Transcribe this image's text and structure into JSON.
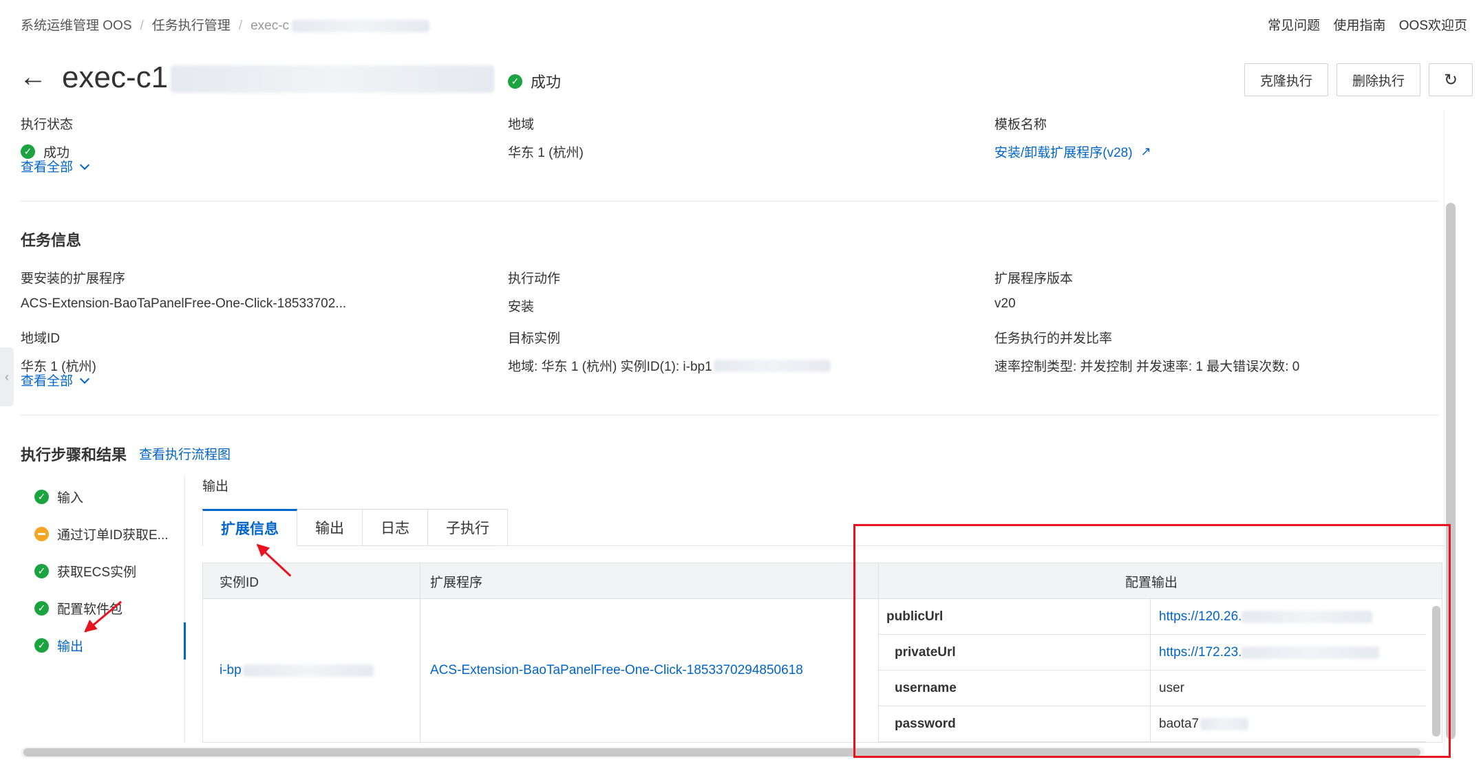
{
  "breadcrumb": {
    "item1": "系统运维管理 OOS",
    "item2": "任务执行管理",
    "current": "exec-c"
  },
  "top_links": {
    "faq": "常见问题",
    "guide": "使用指南",
    "welcome": "OOS欢迎页"
  },
  "header": {
    "title": "exec-c1",
    "status": "成功",
    "clone_button": "克隆执行",
    "delete_button": "删除执行"
  },
  "basic": {
    "status_label": "执行状态",
    "status_value": "成功",
    "region_label": "地域",
    "region_value": "华东 1 (杭州)",
    "template_label": "模板名称",
    "template_value": "安装/卸载扩展程序(v28)",
    "view_all": "查看全部"
  },
  "task_info": {
    "title": "任务信息",
    "ext_label": "要安装的扩展程序",
    "ext_value": "ACS-Extension-BaoTaPanelFree-One-Click-18533702...",
    "action_label": "执行动作",
    "action_value": "安装",
    "version_label": "扩展程序版本",
    "version_value": "v20",
    "regionid_label": "地域ID",
    "regionid_value": "华东 1 (杭州)",
    "target_label": "目标实例",
    "target_value": "地域: 华东 1 (杭州) 实例ID(1): i-bp1",
    "ratio_label": "任务执行的并发比率",
    "ratio_value": "速率控制类型: 并发控制 并发速率: 1 最大错误次数: 0",
    "view_all": "查看全部"
  },
  "steps_section": {
    "title": "执行步骤和结果",
    "flow_link": "查看执行流程图",
    "steps": [
      {
        "label": "输入",
        "status": "success"
      },
      {
        "label": "通过订单ID获取E...",
        "status": "warning"
      },
      {
        "label": "获取ECS实例",
        "status": "success"
      },
      {
        "label": "配置软件包",
        "status": "success"
      },
      {
        "label": "输出",
        "status": "success"
      }
    ]
  },
  "output": {
    "label": "输出",
    "tabs": [
      "扩展信息",
      "输出",
      "日志",
      "子执行"
    ],
    "table": {
      "headers": [
        "实例ID",
        "扩展程序",
        "配置输出"
      ],
      "instance_id": "i-bp",
      "extension": "ACS-Extension-BaoTaPanelFree-One-Click-1853370294850618",
      "config": [
        {
          "key": "publicUrl",
          "value": "https://120.26."
        },
        {
          "key": "privateUrl",
          "value": "https://172.23."
        },
        {
          "key": "username",
          "value": "user"
        },
        {
          "key": "password",
          "value": "baota7"
        }
      ]
    }
  },
  "colors": {
    "link": "#0064c8",
    "success": "#1aa33e",
    "warning": "#f5a623",
    "annotation": "#e8131f"
  }
}
